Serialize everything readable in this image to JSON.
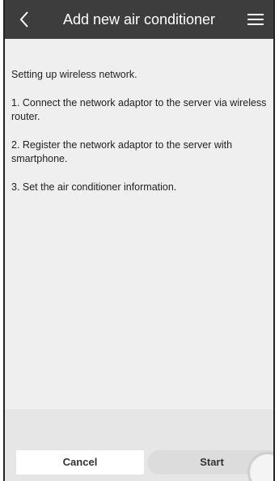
{
  "header": {
    "title": "Add new air conditioner",
    "back_icon": "chevron-left-icon",
    "menu_icon": "hamburger-menu-icon"
  },
  "content": {
    "intro": "Setting up wireless network.",
    "steps": [
      "1. Connect the network adaptor to the server via wireless router.",
      "2. Register the network adaptor to the server with smartphone.",
      "3. Set the air conditioner information."
    ]
  },
  "footer": {
    "cancel_label": "Cancel",
    "start_label": "Start"
  },
  "colors": {
    "header_bg": "#3d3d3d",
    "page_bg": "#efefef",
    "start_bg": "#dcdcdc"
  }
}
